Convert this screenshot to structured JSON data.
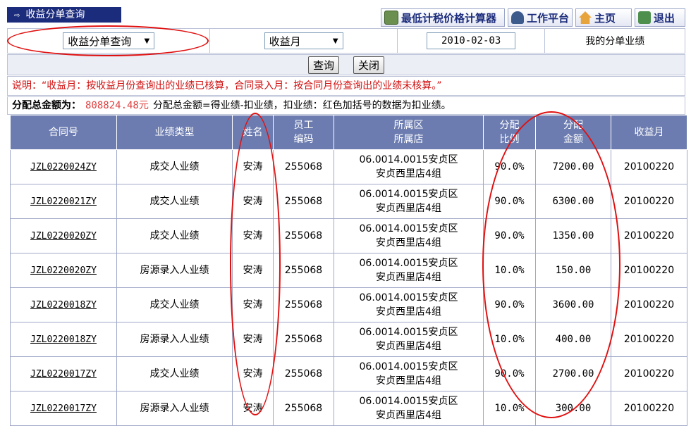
{
  "page_title": "收益分单查询",
  "top_buttons": [
    {
      "label": "最低计税价格计算器",
      "icon": "calculator-icon"
    },
    {
      "label": "工作平台",
      "icon": "user-icon"
    },
    {
      "label": "主页",
      "icon": "home-icon"
    },
    {
      "label": "退出",
      "icon": "exit-icon"
    }
  ],
  "filters": {
    "query_type": "收益分单查询",
    "month_type": "收益月",
    "date_value": "2010-02-03",
    "my_label": "我的分单业绩"
  },
  "actions": {
    "query": "查询",
    "close": "关闭"
  },
  "note": "说明：“收益月：按收益月份查询出的业绩已核算，合同录入月：按合同月份查询出的业绩未核算。”",
  "total": {
    "label": "分配总金额为：",
    "amount": "808824.48元",
    "desc": "分配总金额=得业绩-扣业绩，扣业绩：红色加括号的数据为扣业绩。"
  },
  "table": {
    "headers": [
      "合同号",
      "业绩类型",
      "姓名",
      "员工\n编码",
      "所属区\n所属店",
      "分配\n比例",
      "分配\n金额",
      "收益月"
    ],
    "rows": [
      {
        "contract": "JZL0220024ZY",
        "type": "成交人业绩",
        "name": "安涛",
        "emp": "255068",
        "area": "06.0014.0015安贞区",
        "store": "安贞西里店4组",
        "ratio": "90.0%",
        "amount": "7200.00",
        "month": "20100220"
      },
      {
        "contract": "JZL0220021ZY",
        "type": "成交人业绩",
        "name": "安涛",
        "emp": "255068",
        "area": "06.0014.0015安贞区",
        "store": "安贞西里店4组",
        "ratio": "90.0%",
        "amount": "6300.00",
        "month": "20100220"
      },
      {
        "contract": "JZL0220020ZY",
        "type": "成交人业绩",
        "name": "安涛",
        "emp": "255068",
        "area": "06.0014.0015安贞区",
        "store": "安贞西里店4组",
        "ratio": "90.0%",
        "amount": "1350.00",
        "month": "20100220"
      },
      {
        "contract": "JZL0220020ZY",
        "type": "房源录入人业绩",
        "name": "安涛",
        "emp": "255068",
        "area": "06.0014.0015安贞区",
        "store": "安贞西里店4组",
        "ratio": "10.0%",
        "amount": "150.00",
        "month": "20100220"
      },
      {
        "contract": "JZL0220018ZY",
        "type": "成交人业绩",
        "name": "安涛",
        "emp": "255068",
        "area": "06.0014.0015安贞区",
        "store": "安贞西里店4组",
        "ratio": "90.0%",
        "amount": "3600.00",
        "month": "20100220"
      },
      {
        "contract": "JZL0220018ZY",
        "type": "房源录入人业绩",
        "name": "安涛",
        "emp": "255068",
        "area": "06.0014.0015安贞区",
        "store": "安贞西里店4组",
        "ratio": "10.0%",
        "amount": "400.00",
        "month": "20100220"
      },
      {
        "contract": "JZL0220017ZY",
        "type": "成交人业绩",
        "name": "安涛",
        "emp": "255068",
        "area": "06.0014.0015安贞区",
        "store": "安贞西里店4组",
        "ratio": "90.0%",
        "amount": "2700.00",
        "month": "20100220"
      },
      {
        "contract": "JZL0220017ZY",
        "type": "房源录入人业绩",
        "name": "安涛",
        "emp": "255068",
        "area": "06.0014.0015安贞区",
        "store": "安贞西里店4组",
        "ratio": "10.0%",
        "amount": "300.00",
        "month": "20100220"
      }
    ]
  },
  "colors": {
    "header_bg": "#6c7cb0",
    "title_bg": "#1c2c7c",
    "note_red": "#d01010",
    "annotation_red": "#e01010"
  }
}
